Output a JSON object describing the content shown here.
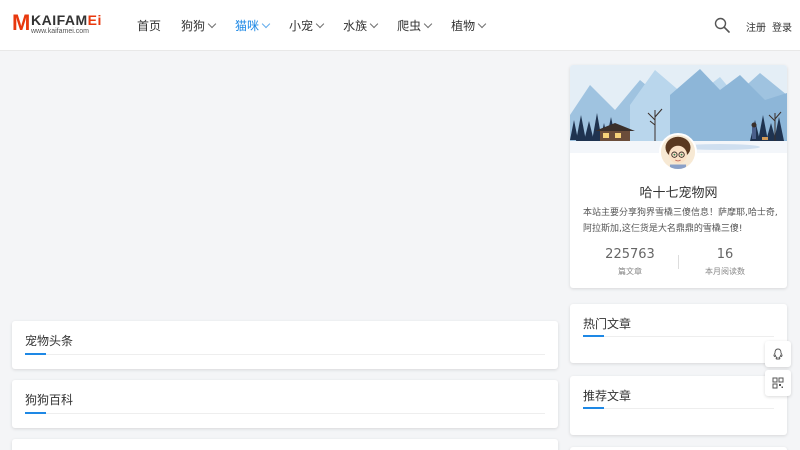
{
  "logo": {
    "letter": "M",
    "word_main": "KAIFAM",
    "word_accent": "Ei",
    "url": "www.kaifamei.com"
  },
  "nav": {
    "items": [
      {
        "label": "首页",
        "dropdown": false,
        "active": false
      },
      {
        "label": "狗狗",
        "dropdown": true,
        "active": false
      },
      {
        "label": "猫咪",
        "dropdown": true,
        "active": true
      },
      {
        "label": "小宠",
        "dropdown": true,
        "active": false
      },
      {
        "label": "水族",
        "dropdown": true,
        "active": false
      },
      {
        "label": "爬虫",
        "dropdown": true,
        "active": false
      },
      {
        "label": "植物",
        "dropdown": true,
        "active": false
      }
    ]
  },
  "header": {
    "search_icon": "search-icon",
    "register_label": "注册",
    "login_label": "登录"
  },
  "main": {
    "sections": [
      {
        "title": "宠物头条"
      },
      {
        "title": "狗狗百科"
      }
    ]
  },
  "profile": {
    "name": "哈十七宠物网",
    "description": "本站主要分享狗界雪橇三傻信息！萨摩耶,哈士奇,阿拉斯加,这仨货是大名鼎鼎的雪橇三傻!",
    "articles_count": "225763",
    "articles_label": "篇文章",
    "reads_count": "16",
    "reads_label": "本月阅读数"
  },
  "sidebar": {
    "hot_title": "热门文章",
    "recommend_title": "推荐文章"
  },
  "floating": {
    "qq_icon": "qq-icon",
    "qrcode_icon": "qrcode-icon"
  },
  "colors": {
    "accent": "#1e88e5",
    "brand": "#e8380d"
  }
}
